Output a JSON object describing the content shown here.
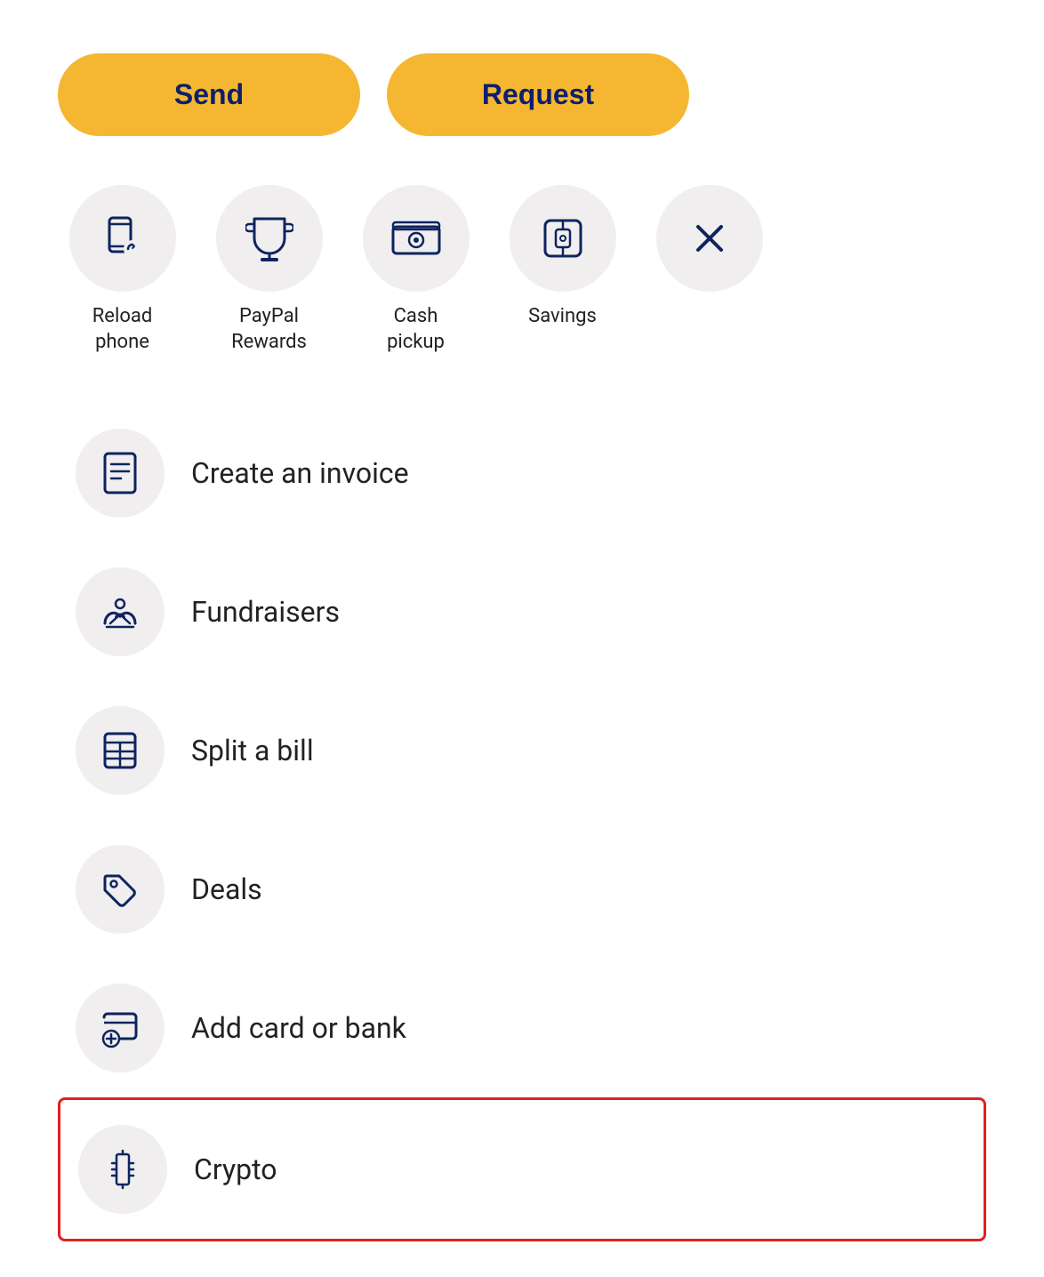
{
  "colors": {
    "brand_yellow": "#F5B731",
    "brand_navy": "#0e2460",
    "icon_bg": "#f0eeee",
    "text_dark": "#222222",
    "highlight_border": "#e02020"
  },
  "action_buttons": [
    {
      "id": "send",
      "label": "Send"
    },
    {
      "id": "request",
      "label": "Request"
    }
  ],
  "quick_actions": [
    {
      "id": "reload-phone",
      "label": "Reload\nphone",
      "icon": "reload-phone-icon"
    },
    {
      "id": "paypal-rewards",
      "label": "PayPal\nRewards",
      "icon": "trophy-icon"
    },
    {
      "id": "cash-pickup",
      "label": "Cash\npickup",
      "icon": "cash-pickup-icon"
    },
    {
      "id": "savings",
      "label": "Savings",
      "icon": "savings-icon"
    },
    {
      "id": "close",
      "label": "",
      "icon": "close-icon"
    }
  ],
  "list_items": [
    {
      "id": "create-invoice",
      "label": "Create an invoice",
      "icon": "invoice-icon",
      "highlighted": false
    },
    {
      "id": "fundraisers",
      "label": "Fundraisers",
      "icon": "fundraisers-icon",
      "highlighted": false
    },
    {
      "id": "split-bill",
      "label": "Split a bill",
      "icon": "split-bill-icon",
      "highlighted": false
    },
    {
      "id": "deals",
      "label": "Deals",
      "icon": "deals-icon",
      "highlighted": false
    },
    {
      "id": "add-card-bank",
      "label": "Add card or bank",
      "icon": "add-card-icon",
      "highlighted": false
    },
    {
      "id": "crypto",
      "label": "Crypto",
      "icon": "crypto-icon",
      "highlighted": true
    }
  ]
}
